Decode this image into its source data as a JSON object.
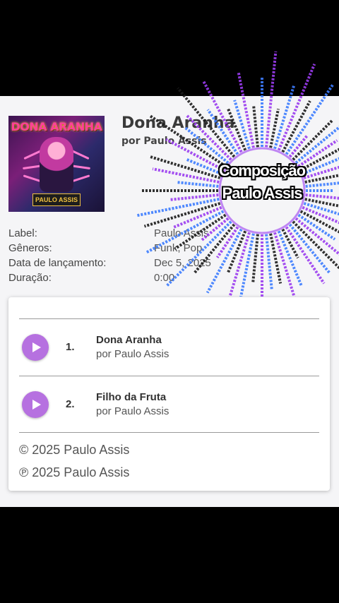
{
  "album": {
    "cover_title": "DONA ARANHA",
    "cover_artist": "PAULO ASSIS",
    "title": "Dona Aranha",
    "by": "por Paulo Assis"
  },
  "meta": [
    {
      "key": "Label:",
      "value": "Paulo Assis"
    },
    {
      "key": "Gêneros:",
      "value": "Funk, Pop"
    },
    {
      "key": "Data de lançamento:",
      "value": "Dec 5, 2025"
    },
    {
      "key": "Duração:",
      "value": "0:00"
    }
  ],
  "tracks": [
    {
      "num": "1.",
      "name": "Dona Aranha",
      "by": "por Paulo Assis"
    },
    {
      "num": "2.",
      "name": "Filho da Fruta",
      "by": "por Paulo Assis"
    }
  ],
  "copyright": "© 2025 Paulo Assis",
  "phonogram": "℗ 2025 Paulo Assis",
  "overlay": {
    "line1": "Composição",
    "line2": "Paulo Assis"
  },
  "colors": {
    "accent": "#b671e0",
    "visualizer_blue": "#3d7dff",
    "visualizer_purple": "#9b3cf0"
  }
}
